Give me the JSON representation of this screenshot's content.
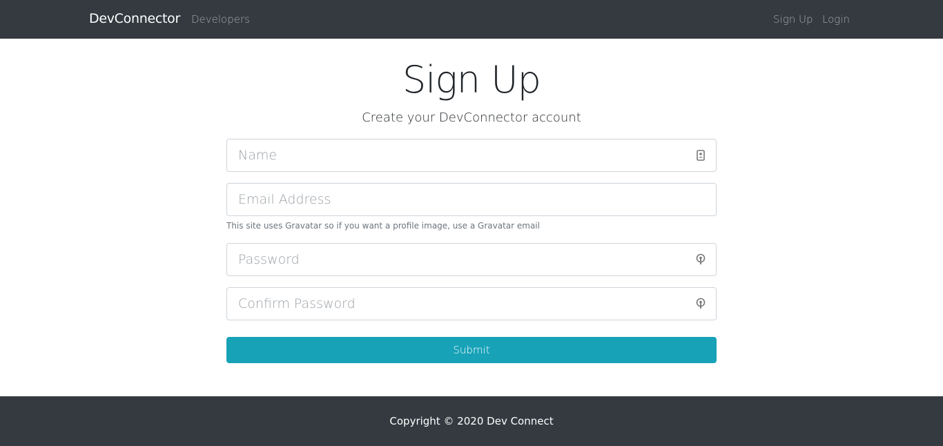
{
  "navbar": {
    "brand": "DevConnector",
    "links": {
      "developers": "Developers",
      "sign_up": "Sign Up",
      "login": "Login"
    },
    "background_color": "#343a40"
  },
  "main": {
    "title": "Sign Up",
    "lead": "Create your DevConnector account",
    "fields": {
      "name": {
        "placeholder": "Name",
        "value": "",
        "icon": "contact-card-icon"
      },
      "email": {
        "placeholder": "Email Address",
        "value": "",
        "help": "This site uses Gravatar so if you want a profile image, use a Gravatar email"
      },
      "password": {
        "placeholder": "Password",
        "value": "",
        "icon": "key-icon"
      },
      "confirm_password": {
        "placeholder": "Confirm Password",
        "value": "",
        "icon": "key-icon"
      }
    },
    "submit_label": "Submit",
    "submit_color": "#17a2b8"
  },
  "footer": {
    "text": "Copyright © 2020 Dev Connect"
  }
}
